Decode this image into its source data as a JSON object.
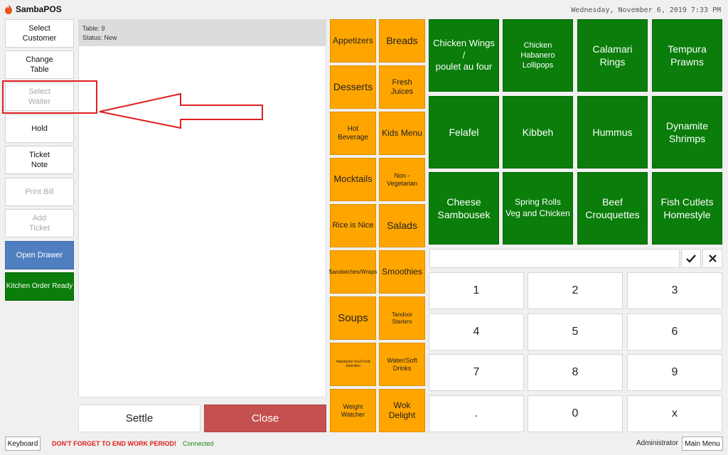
{
  "app": {
    "name": "SambaPOS",
    "datetime": "Wednesday, November 6, 2019 7:33 PM"
  },
  "left_buttons": [
    {
      "label": "Select\nCustomer",
      "state": "normal"
    },
    {
      "label": "Change\nTable",
      "state": "normal"
    },
    {
      "label": "Select\nWaiter",
      "state": "disabled"
    },
    {
      "label": "Hold",
      "state": "normal"
    },
    {
      "label": "Ticket\nNote",
      "state": "normal"
    },
    {
      "label": "Print Bill",
      "state": "disabled"
    },
    {
      "label": "Add\nTicket",
      "state": "disabled"
    },
    {
      "label": "Open Drawer",
      "state": "blue"
    },
    {
      "label": "Kitchen Order Ready",
      "state": "green"
    }
  ],
  "ticket": {
    "table": "Table: 9",
    "status": "Status: New"
  },
  "actions": {
    "settle": "Settle",
    "close": "Close"
  },
  "categories": [
    "Appetizers",
    "Breads",
    "Desserts",
    "Fresh Juices",
    "Hot Beverage",
    "Kids Menu",
    "Mocktails",
    "Non -Vegetarian",
    "Rice is Nice",
    "Salads",
    "Sandwiches/Wraps",
    "Smoothies",
    "Soups",
    "Tandoor Starters",
    "Vegetarian Soul Food Selection",
    "Water/Soft Drinks",
    "Weight Watcher",
    "Wok Delight"
  ],
  "products": [
    "Chicken Wings /\npoulet au four",
    "Chicken Habanero\nLollipops",
    "Calamari\nRings",
    "Tempura\nPrawns",
    "Felafel",
    "Kibbeh",
    "Hummus",
    "Dynamite\nShrimps",
    "Cheese\nSambousek",
    "Spring Rolls\nVeg and Chicken",
    "Beef\nCrouquettes",
    "Fish Cutlets\nHomestyle"
  ],
  "numpad": {
    "keys": [
      "1",
      "2",
      "3",
      "4",
      "5",
      "6",
      "7",
      "8",
      "9",
      ".",
      "0",
      "x"
    ],
    "input_value": ""
  },
  "footer": {
    "keyboard": "Keyboard",
    "warning": "DON'T FORGET TO END WORK PERIOD!",
    "connection": "Connected",
    "user": "Administrator",
    "main_menu": "Main Menu"
  },
  "colors": {
    "category": "#ffa500",
    "product": "#0a7d0a",
    "close": "#c55050",
    "open_drawer": "#4f7fc0",
    "annotation": "#e02020"
  },
  "icons": {
    "logo": "flame-icon",
    "confirm": "check-icon",
    "cancel": "close-icon"
  }
}
